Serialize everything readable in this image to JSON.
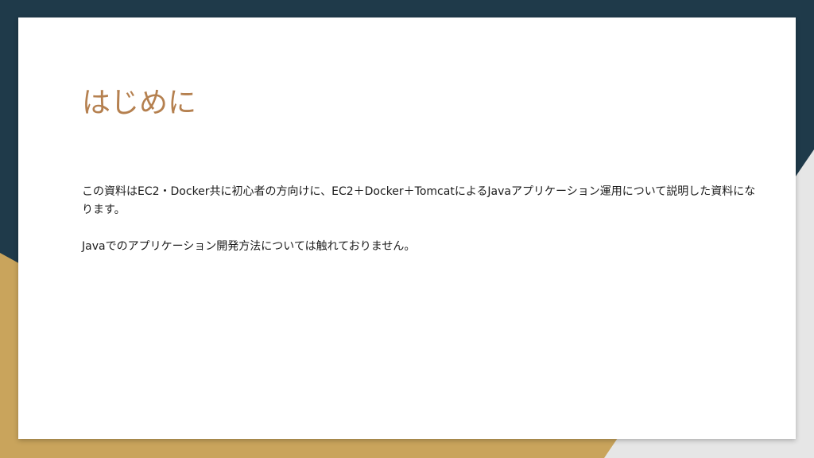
{
  "slide": {
    "title": "はじめに",
    "paragraphs": [
      "この資料はEC2・Docker共に初心者の方向けに、EC2＋Docker＋TomcatによるJavaアプリケーション運用について説明した資料になります。",
      "Javaでのアプリケーション開発方法については触れておりません。"
    ]
  },
  "colors": {
    "background_dark": "#1f3a4a",
    "accent_gold": "#c9a45c",
    "accent_light": "#e6e6e6",
    "title_color": "#b5804f",
    "text_color": "#1a1a1a",
    "card_background": "#ffffff"
  }
}
